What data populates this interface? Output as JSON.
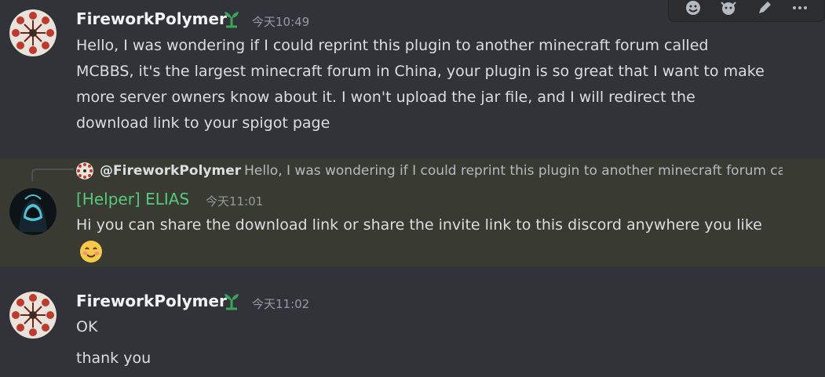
{
  "messages": [
    {
      "username": "FireworkPolymer",
      "timestamp": "今天10:49",
      "text": "Hello, I was wondering if I could reprint this plugin to another minecraft forum called MCBBS, it's the largest minecraft forum in China, your plugin is so great that I want to make more server owners know about it. I won't upload the jar file, and I will redirect the download link to your spigot page"
    },
    {
      "reply_to_name": "@FireworkPolymer",
      "reply_to_text": "Hello, I was wondering if I could reprint this plugin to another minecraft forum called MCBBS",
      "username": "[Helper] ELIAS",
      "timestamp": "今天11:01",
      "text": "Hi you can share the download link or share the invite link to this discord anywhere you like"
    },
    {
      "username": "FireworkPolymer",
      "timestamp": "今天11:02",
      "text": "OK",
      "followup_text": "thank you"
    }
  ],
  "toolbar": {
    "icons": [
      "add-reaction-icon",
      "super-reaction-icon",
      "edit-icon",
      "more-icon"
    ]
  },
  "colors": {
    "background": "#313338",
    "highlight": "#393a32",
    "helper_name": "#57c97a",
    "badge": "#3ba55c"
  }
}
